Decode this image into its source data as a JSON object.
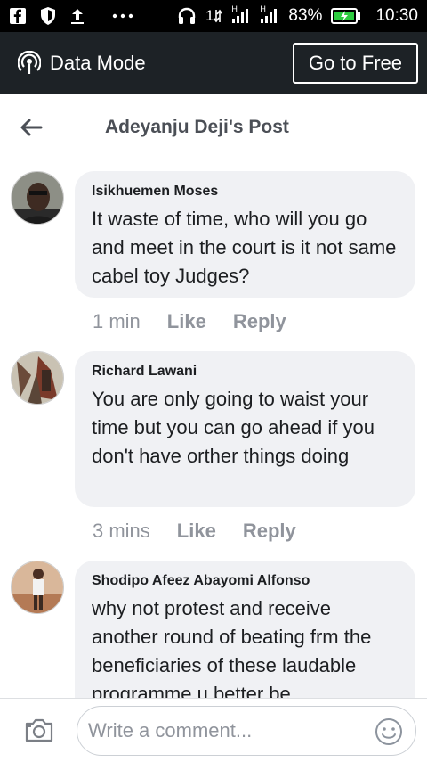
{
  "status_bar": {
    "battery": "83%",
    "time": "10:30",
    "network_label": "1",
    "signal_tag_1": "H",
    "signal_tag_2": "H"
  },
  "mode_bar": {
    "label": "Data Mode",
    "button": "Go to Free"
  },
  "header": {
    "title": "Adeyanju Deji's Post"
  },
  "comments": [
    {
      "author": "Isikhuemen Moses",
      "text": "It waste of time, who will you go and meet in the court is it not same cabel toy Judges?",
      "time": "1 min",
      "like": "Like",
      "reply": "Reply"
    },
    {
      "author": "Richard Lawani",
      "text": "You are only going to waist your time but you can go ahead if you don't have orther things doing",
      "time": "3 mins",
      "like": "Like",
      "reply": "Reply"
    },
    {
      "author": "Shodipo Afeez Abayomi Alfonso",
      "text": "why not protest and receive another round of beating frm the beneficiaries of these laudable programme u better be",
      "time": "",
      "like": "",
      "reply": ""
    }
  ],
  "composer": {
    "placeholder": "Write a comment..."
  }
}
